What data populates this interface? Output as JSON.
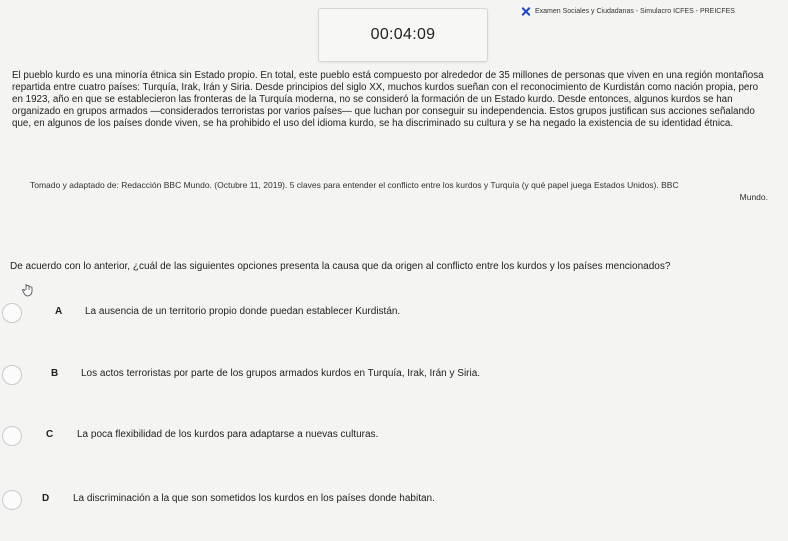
{
  "header": {
    "exam_title": "Examen Sociales y Ciudadanas - Simulacro ICFES - PREICFES",
    "close_icon": "close-x-icon",
    "accent_color": "#1a43c8"
  },
  "timer": {
    "value": "00:04:09"
  },
  "passage": {
    "text": "El pueblo kurdo es una minoría étnica sin Estado propio. En total, este pueblo está compuesto por alrededor de 35 millones de personas que viven en una región montañosa repartida entre cuatro países: Turquía, Irak, Irán y Siria. Desde principios del siglo XX, muchos kurdos sueñan con el reconocimiento de Kurdistán como nación propia, pero en 1923, año en que se establecieron las fronteras de la Turquía moderna, no se consideró la formación de un Estado kurdo. Desde entonces, algunos kurdos se han organizado en grupos armados —considerados terroristas por varios países— que luchan por conseguir su independencia. Estos grupos justifican sus acciones señalando que, en algunos de los países donde viven, se ha prohibido el uso del idioma kurdo, se ha discriminado su cultura y se ha negado la existencia de su identidad étnica.",
    "source": "Tomado y adaptado de: Redacción BBC Mundo. (Octubre 11, 2019). 5 claves para entender el conflicto entre los kurdos y Turquía (y qué papel juega Estados Unidos). BBC",
    "source_end": "Mundo."
  },
  "question": {
    "text": "De acuerdo con lo anterior, ¿cuál de las siguientes opciones presenta la causa que da origen al conflicto entre los kurdos y los países mencionados?",
    "options": [
      {
        "letter": "A",
        "text": "La ausencia de un territorio propio donde puedan establecer Kurdistán."
      },
      {
        "letter": "B",
        "text": "Los actos terroristas por parte de los grupos armados kurdos en Turquía, Irak, Irán y Siria."
      },
      {
        "letter": "C",
        "text": "La poca flexibilidad de los kurdos para adaptarse a nuevas culturas."
      },
      {
        "letter": "D",
        "text": "La discriminación a la que son sometidos los kurdos en los países donde habitan."
      }
    ]
  }
}
